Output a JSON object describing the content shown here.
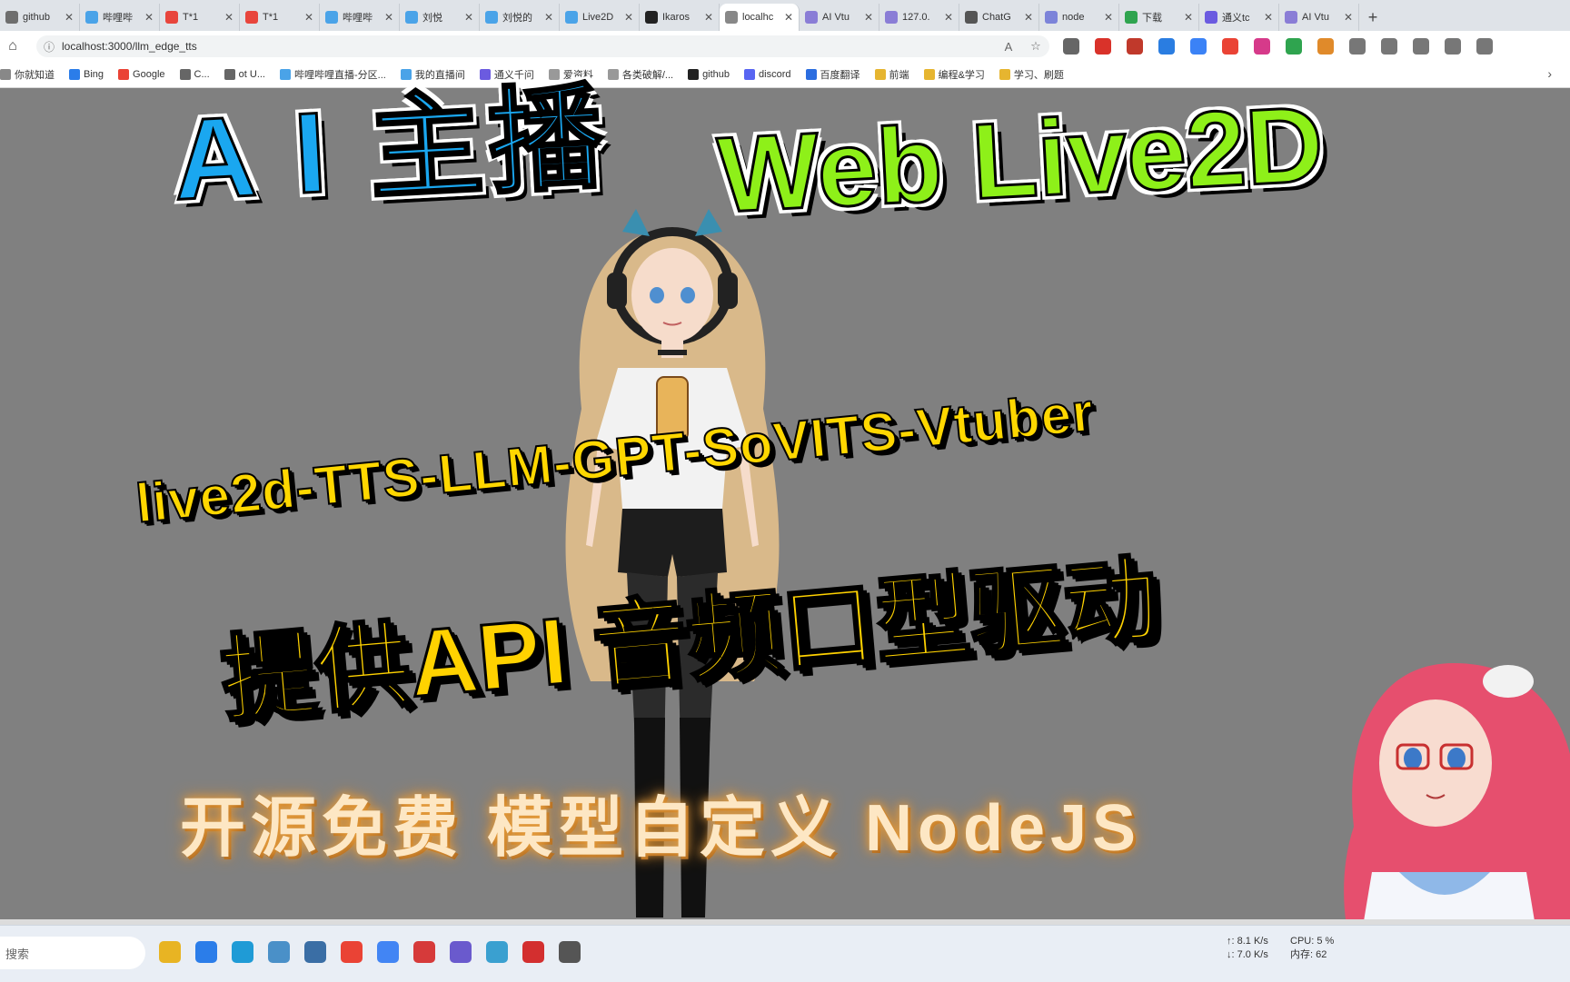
{
  "browser": {
    "tabs": [
      {
        "label": "github",
        "color": "#6e6e6e"
      },
      {
        "label": "哔哩哔",
        "color": "#4aa3e8"
      },
      {
        "label": "T*1",
        "color": "#e8453c"
      },
      {
        "label": "T*1",
        "color": "#e8453c"
      },
      {
        "label": "哔哩哔",
        "color": "#4aa3e8"
      },
      {
        "label": "刘悦",
        "color": "#4aa3e8"
      },
      {
        "label": "刘悦的",
        "color": "#4aa3e8"
      },
      {
        "label": "Live2D",
        "color": "#4aa3e8"
      },
      {
        "label": "Ikaros",
        "color": "#222222"
      },
      {
        "label": "localhc",
        "color": "#888888",
        "active": true
      },
      {
        "label": "AI Vtu",
        "color": "#8a7dd6"
      },
      {
        "label": "127.0.",
        "color": "#8a7dd6"
      },
      {
        "label": "ChatG",
        "color": "#555555"
      },
      {
        "label": "node",
        "color": "#7c83d9"
      },
      {
        "label": "下载",
        "color": "#2fa44f"
      },
      {
        "label": "通义tc",
        "color": "#6b5be0"
      },
      {
        "label": "AI Vtu",
        "color": "#8a7dd6"
      }
    ],
    "close_glyph": "✕",
    "new_tab_glyph": "+",
    "url": "localhost:3000/llm_edge_tts",
    "bookmarks": [
      {
        "label": "你就知道",
        "color": "#888888"
      },
      {
        "label": "Bing",
        "color": "#2b7de9"
      },
      {
        "label": "Google",
        "color": "#ea4335"
      },
      {
        "label": "C...",
        "color": "#666666"
      },
      {
        "label": "ot U...",
        "color": "#666666"
      },
      {
        "label": "哔哩哔哩直播-分区...",
        "color": "#4aa3e8"
      },
      {
        "label": "我的直播间",
        "color": "#4aa3e8"
      },
      {
        "label": "通义千问",
        "color": "#6b5be0"
      },
      {
        "label": "爱资料",
        "color": "#999999"
      },
      {
        "label": "各类破解/...",
        "color": "#999999"
      },
      {
        "label": "github",
        "color": "#222222"
      },
      {
        "label": "discord",
        "color": "#5865f2"
      },
      {
        "label": "百度翻译",
        "color": "#2b6de0"
      },
      {
        "label": "前端",
        "color": "#e6b530"
      },
      {
        "label": "编程&学习",
        "color": "#e6b530"
      },
      {
        "label": "学习、刷题",
        "color": "#e6b530"
      }
    ],
    "extension_colors": [
      "#666666",
      "#d9322a",
      "#c0392b",
      "#2a7de1",
      "#3b82f6",
      "#ea4335",
      "#d63a8a",
      "#2fa44f",
      "#e08a2a",
      "#777777",
      "#777777",
      "#777777",
      "#777777",
      "#777777"
    ]
  },
  "overlay": {
    "title_ai": "A I 主播",
    "title_web": "Web Live2D",
    "repo_name": "live2d-TTS-LLM-GPT-SoVITS-Vtuber",
    "api_line": "提供API 音频口型驱动",
    "features_line": "开源免费 模型自定义 NodeJS"
  },
  "taskbar": {
    "search_placeholder": "搜索",
    "app_colors": [
      "#e8b423",
      "#2b7de9",
      "#1f9bd6",
      "#4a90c8",
      "#3a6ea5",
      "#ea4335",
      "#4285f4",
      "#d63a3a",
      "#6a5acd",
      "#3aa0d0",
      "#d32f2f",
      "#555555"
    ],
    "net_up": "↑: 8.1 K/s",
    "net_down": "↓: 7.0 K/s",
    "cpu": "CPU: 5 %",
    "memory": "内存: 62"
  }
}
